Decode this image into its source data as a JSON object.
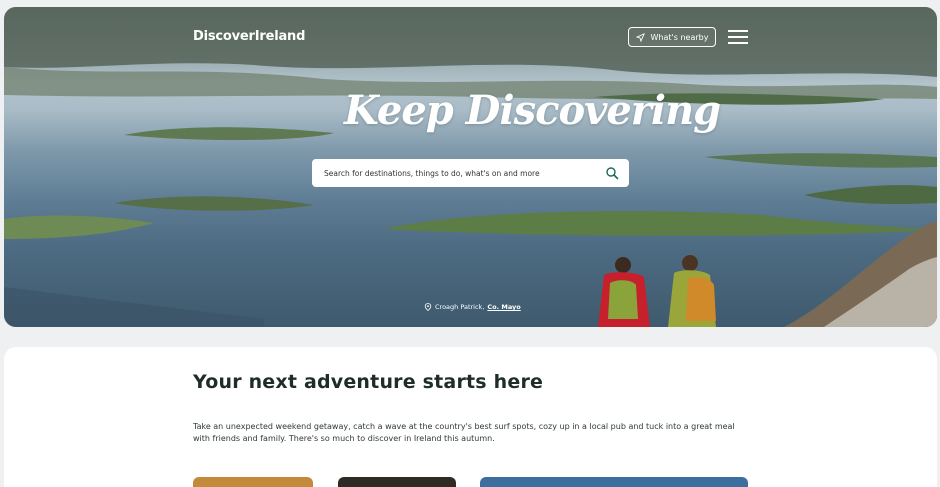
{
  "header": {
    "logo_text": "DiscoverIreland",
    "nearby_label": "What's nearby",
    "menu_icon": "hamburger-menu-icon"
  },
  "hero": {
    "tagline": "Keep Discovering",
    "search_placeholder": "Search for destinations, things to do, what's on and more",
    "photo_place": "Croagh Patrick,",
    "photo_county": "Co. Mayo"
  },
  "intro": {
    "heading": "Your next adventure starts here",
    "body": "Take an unexpected weekend getaway, catch a wave at the country's best surf spots, cozy up in a local pub and tuck into a great meal with friends and family. There's so much to discover in Ireland this autumn."
  },
  "colors": {
    "accent": "#1f2d2a",
    "search_icon": "#1a6b5a"
  }
}
